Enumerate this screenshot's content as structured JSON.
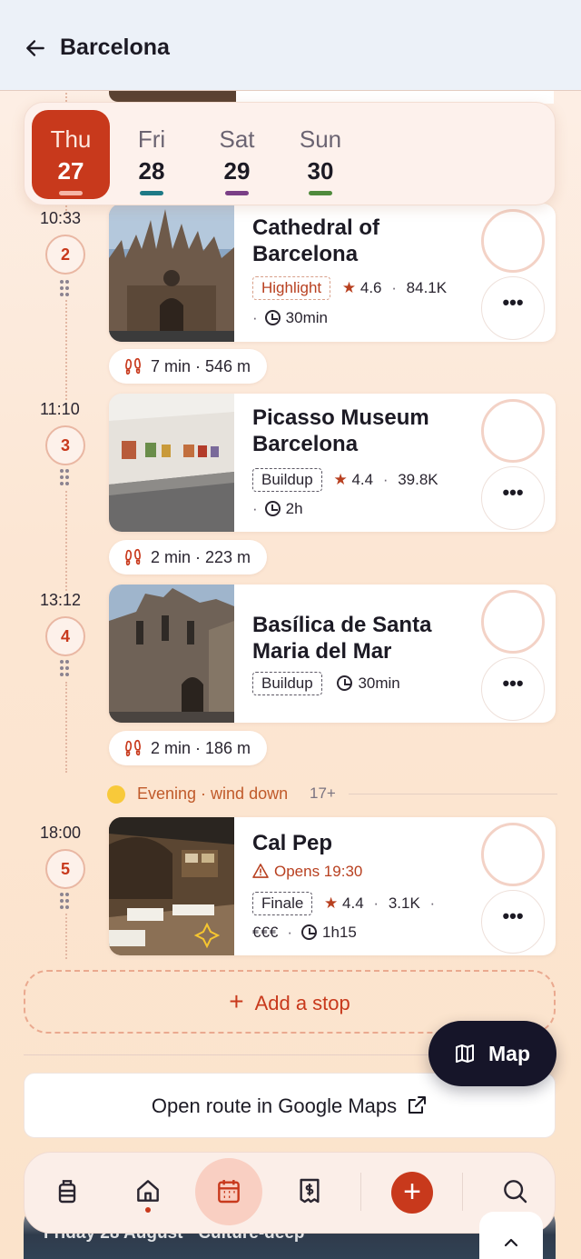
{
  "header": {
    "title": "Barcelona"
  },
  "days": [
    {
      "name": "Thu",
      "num": "27",
      "color": "#f5b5a6",
      "active": true
    },
    {
      "name": "Fri",
      "num": "28",
      "color": "#1e7a86"
    },
    {
      "name": "Sat",
      "num": "29",
      "color": "#7a3f86"
    },
    {
      "name": "Sun",
      "num": "30",
      "color": "#4f8a3c"
    }
  ],
  "stops": [
    {
      "time": "10:33",
      "index": "2",
      "title_line1": "Cathedral of",
      "title_line2": "Barcelona",
      "tag": "Highlight",
      "rating": "4.6",
      "reviews": "84.1K",
      "duration": "30min"
    },
    {
      "time": "11:10",
      "index": "3",
      "title_line1": "Picasso Museum",
      "title_line2": "Barcelona",
      "tag": "Buildup",
      "rating": "4.4",
      "reviews": "39.8K",
      "duration": "2h"
    },
    {
      "time": "13:12",
      "index": "4",
      "title_line1": "Basílica de Santa",
      "title_line2": "Maria del Mar",
      "tag": "Buildup",
      "duration": "30min"
    },
    {
      "time": "18:00",
      "index": "5",
      "title_line1": "Cal Pep",
      "warning": "Opens 19:30",
      "tag": "Finale",
      "rating": "4.4",
      "reviews": "3.1K",
      "price": "€€€",
      "duration": "1h15"
    }
  ],
  "walks": [
    {
      "label": "7 min · 546 m"
    },
    {
      "label": "2 min · 223 m"
    },
    {
      "label": "2 min · 186 m"
    }
  ],
  "evening": {
    "label": "Evening · wind down",
    "age": "17+"
  },
  "add_stop": {
    "label": "Add a stop"
  },
  "map_button": {
    "label": "Map"
  },
  "google_maps": {
    "label": "Open route in Google Maps"
  },
  "next_day": {
    "label": "Friday 28 August · Culture-deep"
  },
  "more_label": "•••",
  "colors": {
    "accent": "#c8391c",
    "dark": "#161529"
  }
}
